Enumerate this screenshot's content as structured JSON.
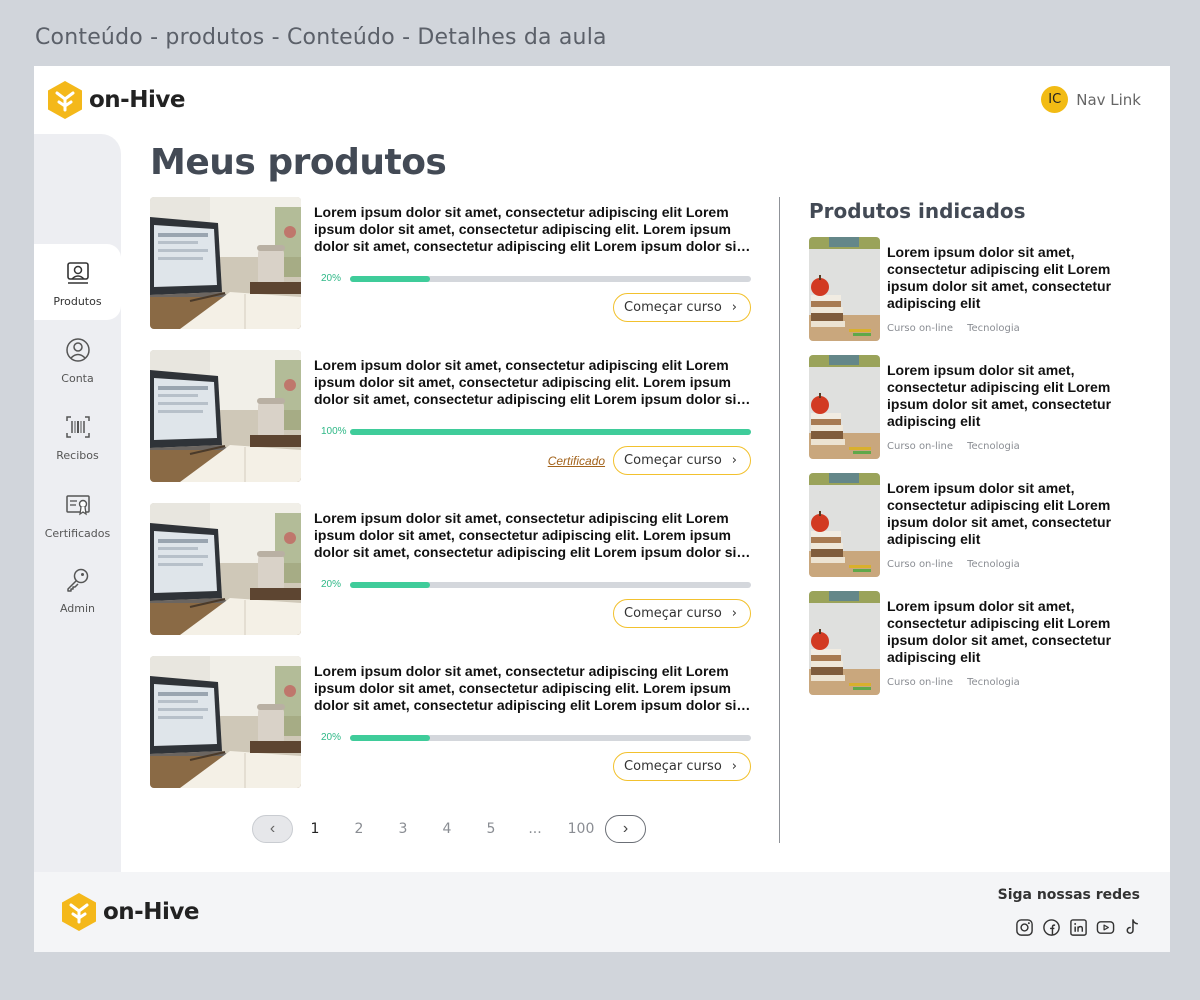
{
  "frame_title": "Conteúdo - produtos - Conteúdo - Detalhes da aula",
  "header": {
    "logo_text": "on-Hive",
    "avatar_initials": "IC",
    "nav_link": "Nav Link"
  },
  "sidebar": {
    "items": [
      {
        "label": "Produtos",
        "icon": "products-icon"
      },
      {
        "label": "Conta",
        "icon": "account-icon"
      },
      {
        "label": "Recibos",
        "icon": "receipt-barcode-icon"
      },
      {
        "label": "Certificados",
        "icon": "certificate-icon"
      },
      {
        "label": "Admin",
        "icon": "key-icon"
      }
    ]
  },
  "main": {
    "title": "Meus produtos",
    "products": [
      {
        "text": "Lorem ipsum dolor sit amet, consectetur adipiscing elit Lorem ipsum dolor sit amet, consectetur adipiscing elit. Lorem ipsum dolor sit amet, consectetur adipiscing elit Lorem ipsum dolor sit amet",
        "progress_label": "20%",
        "progress": 0.2,
        "certificate": "",
        "button": "Começar curso"
      },
      {
        "text": "Lorem ipsum dolor sit amet, consectetur adipiscing elit Lorem ipsum dolor sit amet, consectetur adipiscing elit. Lorem ipsum dolor sit amet, consectetur adipiscing elit Lorem ipsum dolor sit amet",
        "progress_label": "100%",
        "progress": 1.0,
        "certificate": "Certificado",
        "button": "Começar curso"
      },
      {
        "text": "Lorem ipsum dolor sit amet, consectetur adipiscing elit Lorem ipsum dolor sit amet, consectetur adipiscing elit. Lorem ipsum dolor sit amet, consectetur adipiscing elit Lorem ipsum dolor sit amet",
        "progress_label": "20%",
        "progress": 0.2,
        "certificate": "",
        "button": "Começar curso"
      },
      {
        "text": "Lorem ipsum dolor sit amet, consectetur adipiscing elit Lorem ipsum dolor sit amet, consectetur adipiscing elit. Lorem ipsum dolor sit amet, consectetur adipiscing elit Lorem ipsum dolor sit amet",
        "progress_label": "20%",
        "progress": 0.2,
        "certificate": "",
        "button": "Começar curso"
      }
    ],
    "pagination": {
      "pages": [
        "1",
        "2",
        "3",
        "4",
        "5",
        "...",
        "100"
      ],
      "current": "1"
    }
  },
  "recommended": {
    "title": "Produtos indicados",
    "items": [
      {
        "text": "Lorem ipsum dolor sit amet, consectetur adipiscing elit Lorem ipsum dolor sit amet, consectetur adipiscing elit",
        "tag1": "Curso on-line",
        "tag2": "Tecnologia"
      },
      {
        "text": "Lorem ipsum dolor sit amet, consectetur adipiscing elit Lorem ipsum dolor sit amet, consectetur adipiscing elit",
        "tag1": "Curso on-line",
        "tag2": "Tecnologia"
      },
      {
        "text": "Lorem ipsum dolor sit amet, consectetur adipiscing elit Lorem ipsum dolor sit amet, consectetur adipiscing elit",
        "tag1": "Curso on-line",
        "tag2": "Tecnologia"
      },
      {
        "text": "Lorem ipsum dolor sit amet, consectetur adipiscing elit Lorem ipsum dolor sit amet, consectetur adipiscing elit",
        "tag1": "Curso on-line",
        "tag2": "Tecnologia"
      }
    ]
  },
  "footer": {
    "logo_text": "on-Hive",
    "social_title": "Siga nossas redes",
    "social": [
      "instagram-icon",
      "facebook-icon",
      "linkedin-icon",
      "youtube-icon",
      "tiktok-icon"
    ]
  },
  "colors": {
    "brand_yellow": "#f2bb14",
    "progress_green": "#3fcc9a",
    "certificate_brown": "#a2621a",
    "button_border": "#f2c12e"
  }
}
